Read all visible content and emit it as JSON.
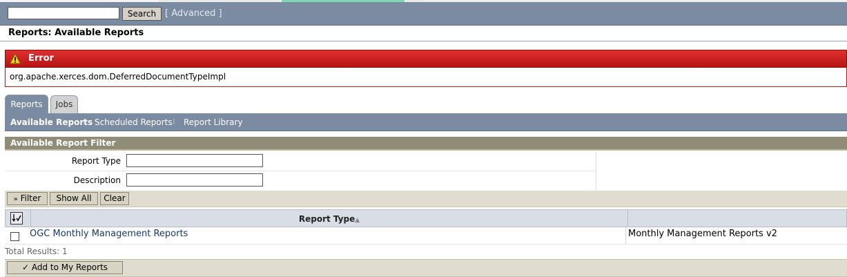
{
  "search": {
    "placeholder": "",
    "value": "",
    "button_label": "Search",
    "advanced_label": "[ Advanced ]"
  },
  "page": {
    "title": "Reports: Available Reports"
  },
  "error": {
    "title": "Error",
    "message": "org.apache.xerces.dom.DeferredDocumentTypeImpl",
    "icon": "warning-icon"
  },
  "tabs": [
    {
      "label": "Reports",
      "active": true
    },
    {
      "label": "Jobs",
      "active": false
    }
  ],
  "subnav": [
    {
      "label": "Available Reports",
      "active": true
    },
    {
      "label": "Scheduled Reports",
      "active": false
    },
    {
      "label": "Report Library",
      "active": false
    }
  ],
  "subnav_separator": "⁞",
  "filter": {
    "header": "Available Report Filter",
    "fields": [
      {
        "label": "Report Type",
        "value": ""
      },
      {
        "label": "Description",
        "value": ""
      }
    ],
    "buttons": {
      "filter": "Filter",
      "filter_glyph": "»",
      "show_all": "Show All",
      "clear": "Clear"
    }
  },
  "table": {
    "columns": [
      {
        "label": "Report Type",
        "sort": "▲"
      },
      {
        "label": ""
      }
    ],
    "rows": [
      {
        "type": "OGC Monthly Management Reports",
        "description": "Monthly Management Reports v2",
        "checked": false
      }
    ],
    "total_results": "Total Results: 1"
  },
  "actions": {
    "add_to_my_reports": "Add to My Reports",
    "add_glyph": "✓"
  },
  "colors": {
    "nav_bar": "#7b8ba1",
    "error_red": "#c41a1a",
    "filter_header": "#8f8c78",
    "link": "#163a6d"
  }
}
